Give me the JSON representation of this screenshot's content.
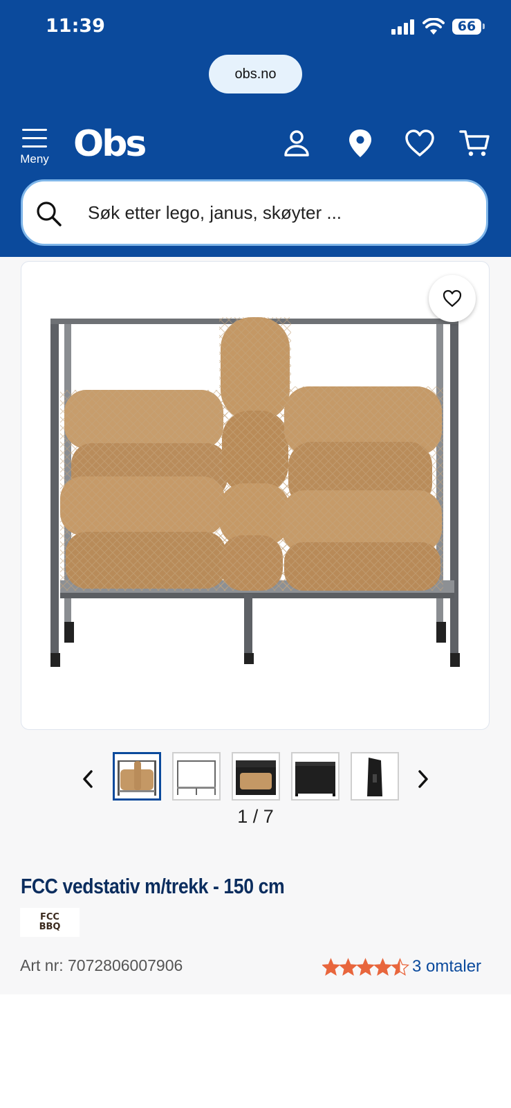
{
  "status_bar": {
    "time": "11:39",
    "battery": "66"
  },
  "browser": {
    "url": "obs.no"
  },
  "header": {
    "menu_label": "Meny",
    "logo_text": "Obs",
    "icons": [
      "user-icon",
      "location-pin-icon",
      "heart-icon",
      "cart-icon"
    ]
  },
  "search": {
    "placeholder": "Søk etter lego, janus, skøyter ..."
  },
  "gallery": {
    "current": 1,
    "total": 7,
    "counter_text": "1 / 7",
    "thumbnails": [
      "rack-with-firewood",
      "empty-rack",
      "rack-with-cover-open",
      "rack-covered",
      "rack-cover-side"
    ]
  },
  "product": {
    "title": "FCC vedstativ m/trekk - 150 cm",
    "brand_logo_text": "FCC BBQ",
    "art_nr": "Art nr: 7072806007906",
    "rating": 4.5,
    "rating_max": 5,
    "reviews": "3 omtaler"
  },
  "colors": {
    "brand_blue": "#0b4a9c",
    "title_navy": "#0b2d5e",
    "star_orange": "#e8663d"
  }
}
